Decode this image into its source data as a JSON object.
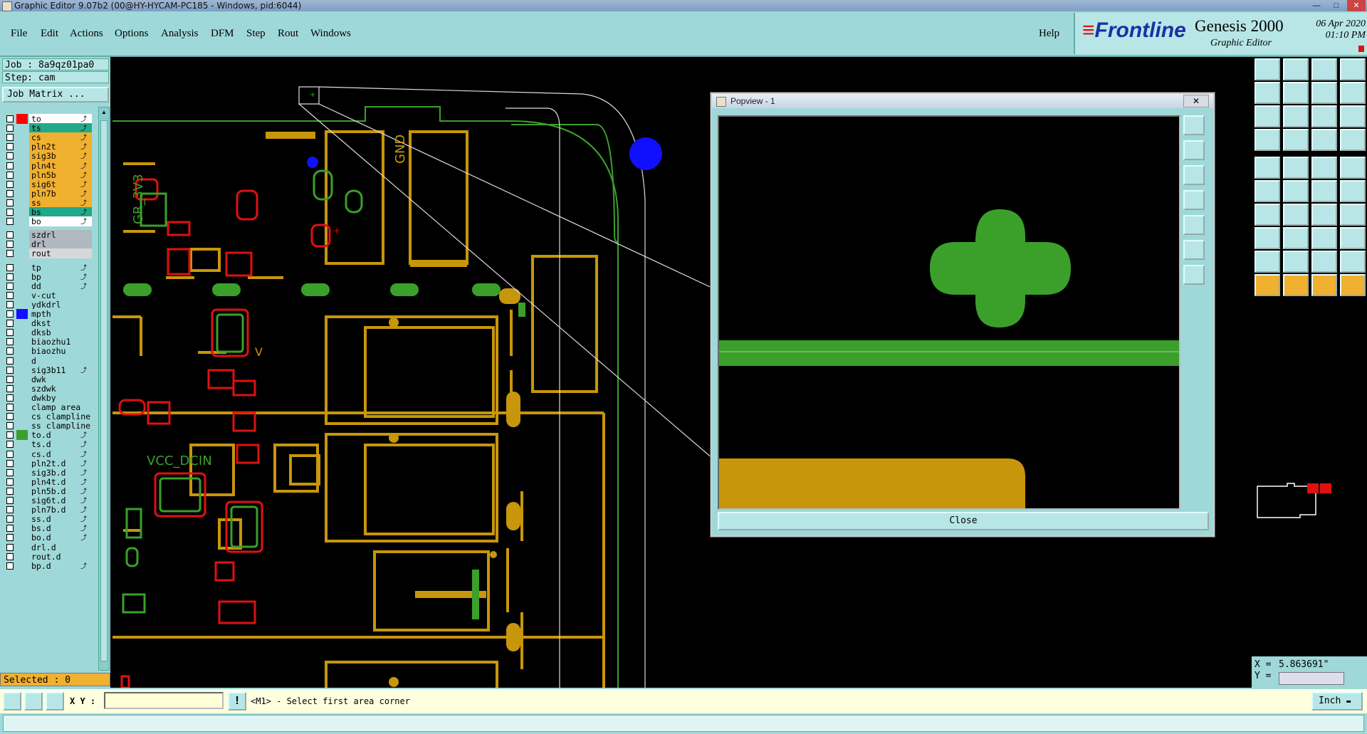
{
  "window": {
    "title": "Graphic Editor 9.07b2 (00@HY-HYCAM-PC185 - Windows, pid:6044)"
  },
  "menu": {
    "items": [
      "File",
      "Edit",
      "Actions",
      "Options",
      "Analysis",
      "DFM",
      "Step",
      "Rout",
      "Windows"
    ],
    "help": "Help"
  },
  "branding": {
    "logo": "Frontline",
    "product": "Genesis 2000",
    "subtitle": "Graphic Editor",
    "date": "06 Apr 2020",
    "time": "01:10 PM"
  },
  "job": {
    "job_label": "Job : 8a9qz01pa0",
    "step_label": "Step: cam",
    "matrix_button": "Job Matrix ..."
  },
  "layers": [
    {
      "name": "to",
      "color": "#ffffff",
      "swatch": "#ff0000",
      "arrow": true
    },
    {
      "name": "ts",
      "color": "#22a88a",
      "swatch": "",
      "arrow": true
    },
    {
      "name": "cs",
      "color": "#f0b030",
      "swatch": "",
      "arrow": true
    },
    {
      "name": "pln2t",
      "color": "#f0b030",
      "swatch": "",
      "arrow": true
    },
    {
      "name": "sig3b",
      "color": "#f0b030",
      "swatch": "",
      "arrow": true
    },
    {
      "name": "pln4t",
      "color": "#f0b030",
      "swatch": "",
      "arrow": true
    },
    {
      "name": "pln5b",
      "color": "#f0b030",
      "swatch": "",
      "arrow": true
    },
    {
      "name": "sig6t",
      "color": "#f0b030",
      "swatch": "",
      "arrow": true
    },
    {
      "name": "pln7b",
      "color": "#f0b030",
      "swatch": "",
      "arrow": true
    },
    {
      "name": "ss",
      "color": "#f0b030",
      "swatch": "",
      "arrow": true
    },
    {
      "name": "bs",
      "color": "#22a88a",
      "swatch": "",
      "arrow": true
    },
    {
      "name": "bo",
      "color": "#ffffff",
      "swatch": "",
      "arrow": true
    },
    {
      "name": "szdrl",
      "color": "#b0b8c0",
      "swatch": "",
      "arrow": false
    },
    {
      "name": "drl",
      "color": "#b0b8c0",
      "swatch": "",
      "arrow": false
    },
    {
      "name": "rout",
      "color": "#d8d8d8",
      "swatch": "",
      "arrow": false
    },
    {
      "name": "tp",
      "color": "#9fd8d8",
      "swatch": "",
      "arrow": true
    },
    {
      "name": "bp",
      "color": "#9fd8d8",
      "swatch": "",
      "arrow": true
    },
    {
      "name": "dd",
      "color": "#9fd8d8",
      "swatch": "",
      "arrow": true
    },
    {
      "name": "v-cut",
      "color": "#9fd8d8",
      "swatch": "",
      "arrow": false
    },
    {
      "name": "ydkdrl",
      "color": "#9fd8d8",
      "swatch": "",
      "arrow": false
    },
    {
      "name": "mpth",
      "color": "#9fd8d8",
      "swatch": "#1010ff",
      "arrow": false
    },
    {
      "name": "dkst",
      "color": "#9fd8d8",
      "swatch": "",
      "arrow": false
    },
    {
      "name": "dksb",
      "color": "#9fd8d8",
      "swatch": "",
      "arrow": false
    },
    {
      "name": "biaozhu1",
      "color": "#9fd8d8",
      "swatch": "",
      "arrow": false
    },
    {
      "name": "biaozhu",
      "color": "#9fd8d8",
      "swatch": "",
      "arrow": false
    },
    {
      "name": "d",
      "color": "#9fd8d8",
      "swatch": "",
      "arrow": false
    },
    {
      "name": "sig3b11",
      "color": "#9fd8d8",
      "swatch": "",
      "arrow": true
    },
    {
      "name": "dwk",
      "color": "#9fd8d8",
      "swatch": "",
      "arrow": false
    },
    {
      "name": "szdwk",
      "color": "#9fd8d8",
      "swatch": "",
      "arrow": false
    },
    {
      "name": "dwkby",
      "color": "#9fd8d8",
      "swatch": "",
      "arrow": false
    },
    {
      "name": "clamp_area",
      "color": "#9fd8d8",
      "swatch": "",
      "arrow": false
    },
    {
      "name": "cs_clampline",
      "color": "#9fd8d8",
      "swatch": "",
      "arrow": false
    },
    {
      "name": "ss_clampline",
      "color": "#9fd8d8",
      "swatch": "",
      "arrow": false
    },
    {
      "name": "to.d",
      "color": "#9fd8d8",
      "swatch": "#3aa02a",
      "arrow": true
    },
    {
      "name": "ts.d",
      "color": "#9fd8d8",
      "swatch": "",
      "arrow": true
    },
    {
      "name": "cs.d",
      "color": "#9fd8d8",
      "swatch": "",
      "arrow": true
    },
    {
      "name": "pln2t.d",
      "color": "#9fd8d8",
      "swatch": "",
      "arrow": true
    },
    {
      "name": "sig3b.d",
      "color": "#9fd8d8",
      "swatch": "",
      "arrow": true
    },
    {
      "name": "pln4t.d",
      "color": "#9fd8d8",
      "swatch": "",
      "arrow": true
    },
    {
      "name": "pln5b.d",
      "color": "#9fd8d8",
      "swatch": "",
      "arrow": true
    },
    {
      "name": "sig6t.d",
      "color": "#9fd8d8",
      "swatch": "",
      "arrow": true
    },
    {
      "name": "pln7b.d",
      "color": "#9fd8d8",
      "swatch": "",
      "arrow": true
    },
    {
      "name": "ss.d",
      "color": "#9fd8d8",
      "swatch": "",
      "arrow": true
    },
    {
      "name": "bs.d",
      "color": "#9fd8d8",
      "swatch": "",
      "arrow": true
    },
    {
      "name": "bo.d",
      "color": "#9fd8d8",
      "swatch": "",
      "arrow": true
    },
    {
      "name": "drl.d",
      "color": "#9fd8d8",
      "swatch": "",
      "arrow": false
    },
    {
      "name": "rout.d",
      "color": "#9fd8d8",
      "swatch": "",
      "arrow": false
    },
    {
      "name": "bp.d",
      "color": "#9fd8d8",
      "swatch": "",
      "arrow": true
    }
  ],
  "selection": {
    "label": "Selected : 0"
  },
  "board_labels": {
    "gnd": "GND",
    "gr3v3": "GR_3V3",
    "vcc": "VCC_DCIN",
    "v": "V"
  },
  "popview": {
    "title": "Popview - 1",
    "close_button": "Close"
  },
  "coords": {
    "x_label": "X =",
    "x_value": "5.863691\"",
    "y_label": "Y ="
  },
  "command": {
    "xy_label": "X Y :",
    "xy_value": "",
    "prompt": "<M1> - Select first area corner",
    "units": "Inch"
  },
  "colors": {
    "panel": "#9fd8d8",
    "copper": "#c8960a",
    "green": "#3aa02a",
    "red": "#e01010",
    "highlight": "#f0b030"
  }
}
